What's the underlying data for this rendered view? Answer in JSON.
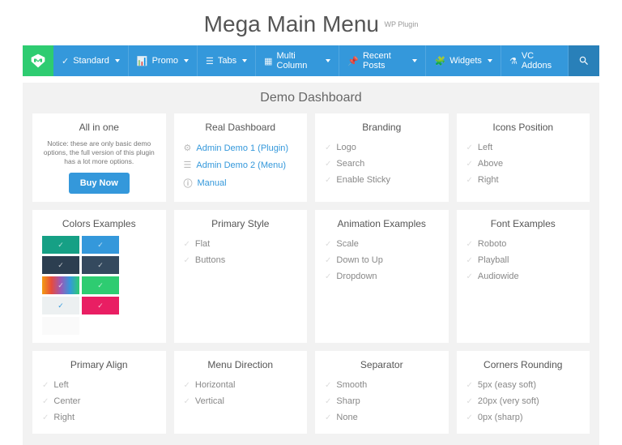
{
  "header": {
    "title": "Mega Main Menu",
    "subtitle": "WP Plugin"
  },
  "nav": {
    "items": [
      {
        "label": "Standard"
      },
      {
        "label": "Promo"
      },
      {
        "label": "Tabs"
      },
      {
        "label": "Multi Column"
      },
      {
        "label": "Recent Posts"
      },
      {
        "label": "Widgets"
      },
      {
        "label": "VC Addons"
      }
    ]
  },
  "dashboard_title": "Demo Dashboard",
  "cards": {
    "allinone": {
      "title": "All in one",
      "notice": "Notice: these are only basic demo options, the full version of this plugin has a lot more options.",
      "buy": "Buy Now"
    },
    "real": {
      "title": "Real Dashboard",
      "admin1": "Admin Demo 1 (Plugin)",
      "admin2": "Admin Demo 2 (Menu)",
      "manual": "Manual"
    },
    "branding": {
      "title": "Branding",
      "i0": "Logo",
      "i1": "Search",
      "i2": "Enable Sticky"
    },
    "icons": {
      "title": "Icons Position",
      "i0": "Left",
      "i1": "Above",
      "i2": "Right"
    },
    "colors": {
      "title": "Colors Examples"
    },
    "pstyle": {
      "title": "Primary Style",
      "i0": "Flat",
      "i1": "Buttons"
    },
    "anim": {
      "title": "Animation Examples",
      "i0": "Scale",
      "i1": "Down to Up",
      "i2": "Dropdown"
    },
    "font": {
      "title": "Font Examples",
      "i0": "Roboto",
      "i1": "Playball",
      "i2": "Audiowide"
    },
    "align": {
      "title": "Primary Align",
      "i0": "Left",
      "i1": "Center",
      "i2": "Right"
    },
    "mdir": {
      "title": "Menu Direction",
      "i0": "Horizontal",
      "i1": "Vertical"
    },
    "sep": {
      "title": "Separator",
      "i0": "Smooth",
      "i1": "Sharp",
      "i2": "None"
    },
    "corners": {
      "title": "Corners Rounding",
      "i0": "5px (easy soft)",
      "i1": "20px (very soft)",
      "i2": "0px (sharp)"
    }
  }
}
